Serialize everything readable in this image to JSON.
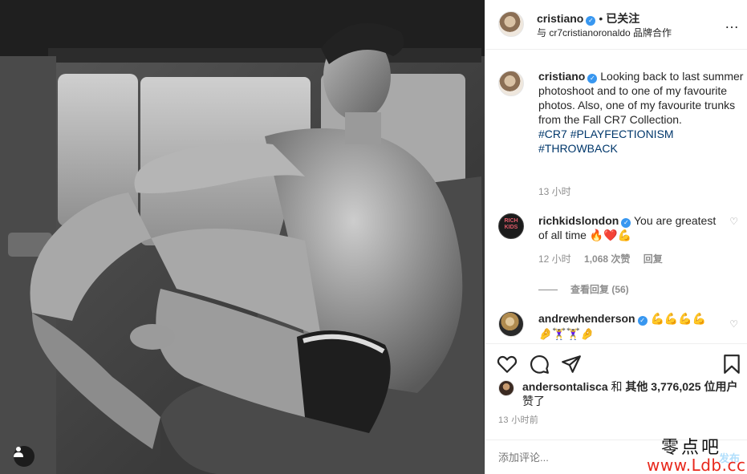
{
  "post": {
    "image_description_icon": "user-tag-icon"
  },
  "header": {
    "username": "cristiano",
    "separator": "•",
    "follow_status": "已关注",
    "partnership": "与 cr7cristianoronaldo 品牌合作",
    "more_icon": "…"
  },
  "caption": {
    "username": "cristiano",
    "text": "Looking back to last summer photoshoot and to one of my favourite photos. Also, one of my favourite trunks from the Fall CR7 Collection.",
    "hashtags": [
      "#CR7",
      "#PLAYFECTIONISM",
      "#THROWBACK"
    ],
    "time": "13 小时"
  },
  "comments": [
    {
      "username": "richkidslondon",
      "text": "You are greatest of all time",
      "emojis": "🔥❤️💪",
      "time": "12 小时",
      "likes": "1,068 次赞",
      "reply": "回复",
      "view_replies": "查看回复 (56)",
      "avatar_text": "RICH KIDS"
    },
    {
      "username": "andrewhenderson",
      "emojis_inline": "💪💪💪💪",
      "text_line2": "🤌🏋️‍♀️🏋️‍♀️🤌"
    }
  ],
  "actions": {
    "likers_name": "andersontalisca",
    "likes_connector": "和",
    "likes_others": "其他 3,776,025 位用户",
    "likes_suffix": "赞了",
    "post_time": "13 小时前"
  },
  "add_comment": {
    "placeholder": "添加评论...",
    "post_label": "发布"
  },
  "watermark": {
    "top": "零点吧",
    "bottom": "www.Ldb.cc"
  },
  "colors": {
    "link": "#00376b",
    "verified": "#3897f0",
    "muted": "#8e8e8e",
    "post_button": "#b2dffc",
    "watermark_red": "#e8281c"
  }
}
